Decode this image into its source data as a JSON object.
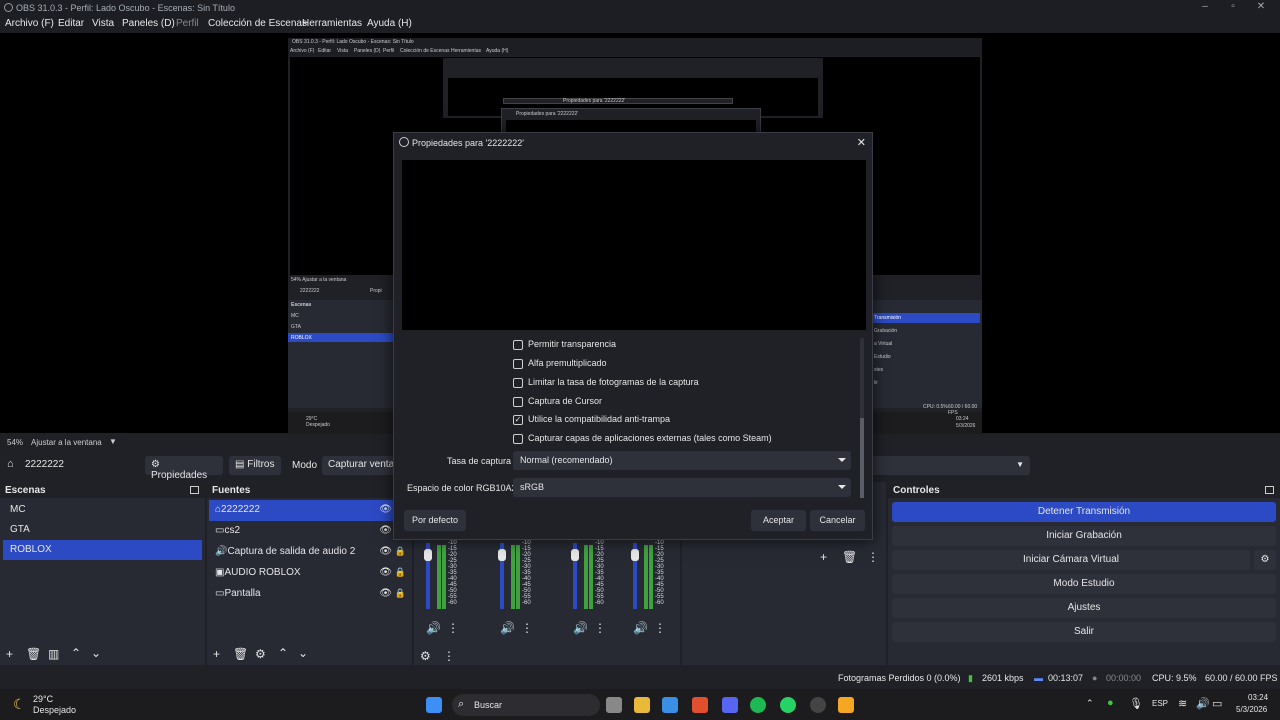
{
  "window": {
    "title": "OBS 31.0.3 - Perfil: Lado Oscubo - Escenas: Sin Título"
  },
  "menu": [
    "Archivo (F)",
    "Editar",
    "Vista",
    "Paneles (D)",
    "Perfil",
    "Colección de Escenas",
    "Herramientas",
    "Ayuda (H)"
  ],
  "nested": {
    "title": "OBS 31.0.3 - Perfil: Lado Oscubo - Escenas: Sin Título",
    "menu": [
      "Archivo (F)",
      "Editar",
      "Vista",
      "Paneles (D)",
      "Perfil",
      "Colección de Escenas",
      "Herramientas",
      "Ayuda (H)"
    ],
    "dlg1": "Propiedades para '2222222'",
    "dlg2": "Propiedades para '2222222'",
    "zoom": "54%   Ajustar a la ventana",
    "source": "2222222",
    "props_btn": "Propi",
    "scenes_head": "Escenas",
    "scenes": [
      "MC",
      "GTA",
      "ROBLOX"
    ],
    "ctl": [
      "Transmisión",
      "Grabación",
      "a Virtual",
      "Estudio",
      "stes",
      "lir"
    ],
    "weather_temp": "29°C",
    "weather_desc": "Despejado",
    "status": "CPU: 0.5%",
    "fps": "60.00 / 60.00 FPS",
    "time": "03:24",
    "date": "5/3/2026"
  },
  "zoom": {
    "percent": "54%",
    "fit": "Ajustar a la ventana"
  },
  "sourcebar": {
    "name": "2222222",
    "properties": "Propiedades",
    "filters": "Filtros",
    "mode_label": "Modo",
    "mode_value": "Capturar ventan"
  },
  "scenes": {
    "title": "Escenas",
    "items": [
      "MC",
      "GTA",
      "ROBLOX"
    ],
    "selected": 2
  },
  "sources": {
    "title": "Fuentes",
    "items": [
      {
        "name": "2222222",
        "icon": "gamepad-icon"
      },
      {
        "name": "cs2",
        "icon": "window-icon"
      },
      {
        "name": "Captura de salida de audio 2",
        "icon": "speaker-icon"
      },
      {
        "name": "AUDIO ROBLOX",
        "icon": "image-icon"
      },
      {
        "name": "Pantalla",
        "icon": "monitor-icon"
      }
    ]
  },
  "mixer": {
    "scale": [
      "-10",
      "-15",
      "-20",
      "-25",
      "-30",
      "-35",
      "-40",
      "-45",
      "-50",
      "-55",
      "-60"
    ]
  },
  "controls": {
    "title": "Controles",
    "buttons": [
      "Detener Transmisión",
      "Iniciar Grabación",
      "Iniciar Cámara Virtual",
      "Modo Estudio",
      "Ajustes",
      "Salir"
    ]
  },
  "dialog": {
    "title": "Propiedades para '2222222'",
    "checkboxes": [
      {
        "label": "Permitir transparencia",
        "checked": false
      },
      {
        "label": "Alfa premultiplicado",
        "checked": false
      },
      {
        "label": "Limitar la tasa de fotogramas de la captura",
        "checked": false
      },
      {
        "label": "Captura de Cursor",
        "checked": false
      },
      {
        "label": "Utilice la compatibilidad anti-trampa",
        "checked": true
      },
      {
        "label": "Capturar capas de aplicaciones externas (tales como Steam)",
        "checked": false
      }
    ],
    "rate_label": "Tasa de captura",
    "rate_value": "Normal (recomendado)",
    "color_label": "Espacio de color RGB10A2",
    "color_value": "sRGB",
    "defaults": "Por defecto",
    "accept": "Aceptar",
    "cancel": "Cancelar",
    "check_mark": "✓"
  },
  "status": {
    "dropped": "Fotogramas Perdidos 0 (0.0%)",
    "bitrate": "2601 kbps",
    "stream_time": "00:13:07",
    "rec_time": "00:00:00",
    "cpu": "CPU: 9.5%",
    "fps": "60.00 / 60.00 FPS"
  },
  "taskbar": {
    "weather_temp": "29°C",
    "weather_desc": "Despejado",
    "search": "Buscar",
    "lang": "ESP",
    "time": "03:24",
    "date": "5/3/2026"
  },
  "colors": {
    "accent": "#2c4ac4",
    "panel": "#272a33",
    "bg": "#1f2127"
  }
}
